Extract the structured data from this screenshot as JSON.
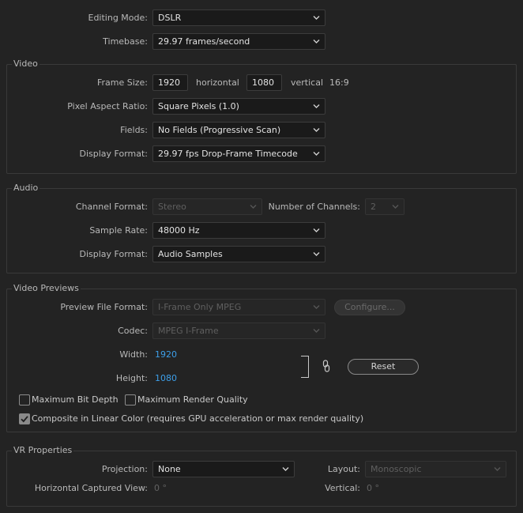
{
  "top": {
    "editing_mode_label": "Editing Mode:",
    "editing_mode_value": "DSLR",
    "timebase_label": "Timebase:",
    "timebase_value": "29.97  frames/second"
  },
  "video": {
    "title": "Video",
    "frame_size_label": "Frame Size:",
    "frame_width": "1920",
    "horizontal_label": "horizontal",
    "frame_height": "1080",
    "vertical_label": "vertical",
    "aspect": "16:9",
    "par_label": "Pixel Aspect Ratio:",
    "par_value": "Square Pixels (1.0)",
    "fields_label": "Fields:",
    "fields_value": "No Fields (Progressive Scan)",
    "display_format_label": "Display Format:",
    "display_format_value": "29.97 fps Drop-Frame Timecode"
  },
  "audio": {
    "title": "Audio",
    "channel_format_label": "Channel Format:",
    "channel_format_value": "Stereo",
    "num_channels_label": "Number of Channels:",
    "num_channels_value": "2",
    "sample_rate_label": "Sample Rate:",
    "sample_rate_value": "48000 Hz",
    "display_format_label": "Display Format:",
    "display_format_value": "Audio Samples"
  },
  "previews": {
    "title": "Video Previews",
    "file_format_label": "Preview File Format:",
    "file_format_value": "I-Frame Only MPEG",
    "configure_label": "Configure...",
    "codec_label": "Codec:",
    "codec_value": "MPEG I-Frame",
    "width_label": "Width:",
    "width_value": "1920",
    "height_label": "Height:",
    "height_value": "1080",
    "reset_label": "Reset",
    "max_bit_depth_label": "Maximum Bit Depth",
    "max_bit_depth_checked": false,
    "max_render_quality_label": "Maximum Render Quality",
    "max_render_quality_checked": false,
    "linear_color_label": "Composite in Linear Color (requires GPU acceleration or max render quality)",
    "linear_color_checked": true
  },
  "vr": {
    "title": "VR Properties",
    "projection_label": "Projection:",
    "projection_value": "None",
    "layout_label": "Layout:",
    "layout_value": "Monoscopic",
    "hcv_label": "Horizontal Captured View:",
    "hcv_value": "0 °",
    "vertical_label": "Vertical:",
    "vertical_value": "0 °"
  },
  "colors": {
    "background": "#232323",
    "accent_blue": "#3d9fe9",
    "field_bg": "#1a1a1a"
  },
  "icons": [
    "chevron-down-icon",
    "link-icon",
    "checkmark-icon"
  ]
}
